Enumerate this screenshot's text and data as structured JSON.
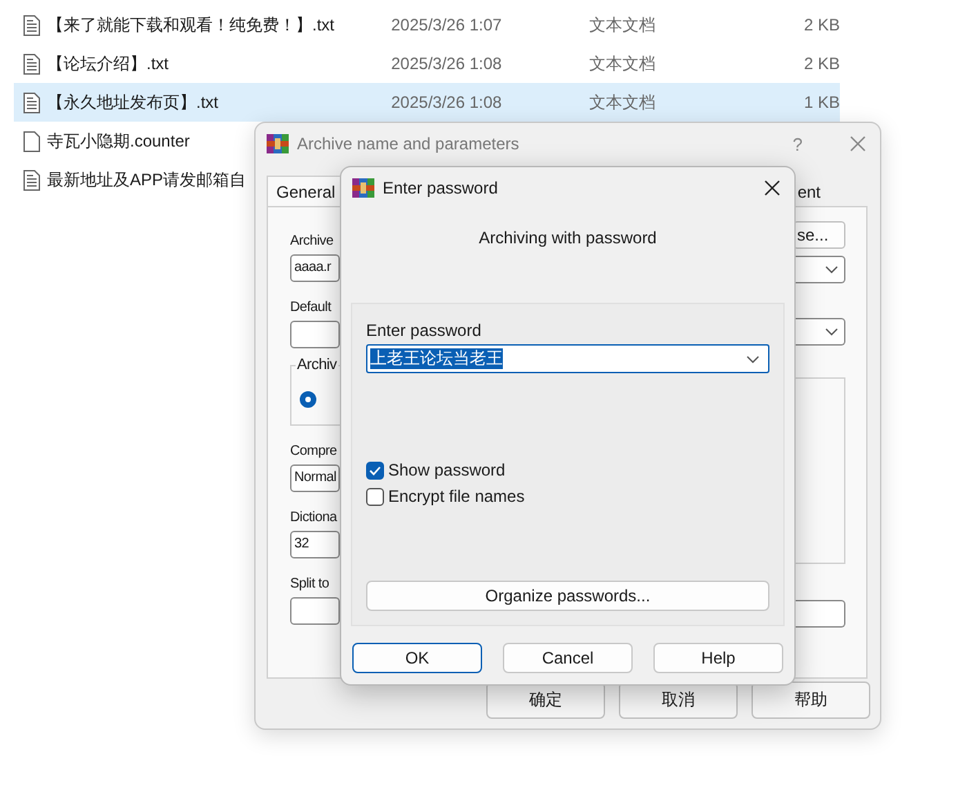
{
  "files": [
    {
      "kind": "document",
      "name": "【来了就能下载和观看！纯免费！】.txt",
      "modified": "2025/3/26 1:07",
      "type": "文本文档",
      "size": "2 KB",
      "selected": false
    },
    {
      "kind": "document",
      "name": "【论坛介绍】.txt",
      "modified": "2025/3/26 1:08",
      "type": "文本文档",
      "size": "2 KB",
      "selected": false
    },
    {
      "kind": "document",
      "name": "【永久地址发布页】.txt",
      "modified": "2025/3/26 1:08",
      "type": "文本文档",
      "size": "1 KB",
      "selected": true
    },
    {
      "kind": "blank",
      "name": "寺瓦小隐期.counter",
      "selected": false
    },
    {
      "kind": "document",
      "name": "最新地址及APP请发邮箱自",
      "selected": false
    }
  ],
  "archive_dialog": {
    "title": "Archive name and parameters",
    "help": "?",
    "tabs": [
      {
        "label": "General",
        "selected": true
      },
      {
        "label": "ent",
        "selected": false
      }
    ],
    "left": [
      {
        "kind": "label",
        "text": "Archive"
      },
      {
        "kind": "field",
        "value": "aaaa.r"
      },
      {
        "kind": "label",
        "text": "Default"
      },
      {
        "kind": "field"
      },
      {
        "kind": "group",
        "legend": "Archiv",
        "radio_selected": true
      },
      {
        "kind": "label",
        "text": "Compre"
      },
      {
        "kind": "field",
        "value": "Normal"
      },
      {
        "kind": "label",
        "text": "Dictiona"
      },
      {
        "kind": "field",
        "value": "32"
      },
      {
        "kind": "label",
        "text": "Split to"
      },
      {
        "kind": "field"
      }
    ],
    "right": [
      {
        "kind": "button",
        "label": "se..."
      },
      {
        "kind": "dropdown"
      },
      {
        "kind": "dropdown"
      },
      {
        "kind": "group"
      },
      {
        "kind": "field"
      }
    ],
    "buttons": [
      "确定",
      "取消",
      "帮助"
    ]
  },
  "password_dialog": {
    "title": "Enter password",
    "heading": "Archiving with password",
    "password_label": "Enter password",
    "password_value": "上老王论坛当老王",
    "options": [
      {
        "label": "Show password",
        "checked": true
      },
      {
        "label": "Encrypt file names",
        "checked": false
      }
    ],
    "organize_button": "Organize passwords...",
    "buttons": [
      {
        "label": "OK",
        "default": true
      },
      {
        "label": "Cancel",
        "default": false
      },
      {
        "label": "Help",
        "default": false
      }
    ]
  }
}
